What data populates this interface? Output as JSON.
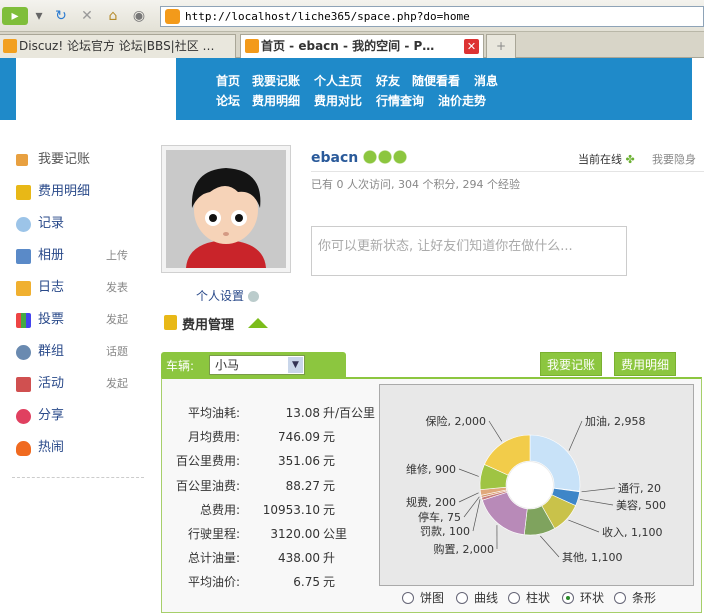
{
  "browser": {
    "url": "http://localhost/liche365/space.php?do=home",
    "tabs": [
      {
        "label": "Discuz! 论坛官方 论坛|BBS|社区 …"
      },
      {
        "label": "首页 - ebacn - 我的空间 - P…"
      }
    ]
  },
  "nav": {
    "row1": [
      "首页",
      "我要记账",
      "个人主页",
      "好友",
      "随便看看",
      "消息"
    ],
    "row2": [
      "论坛",
      "费用明细",
      "费用对比",
      "行情查询",
      "油价走势"
    ]
  },
  "sidebar": {
    "items": [
      {
        "label": "我要记账",
        "sub": ""
      },
      {
        "label": "费用明细",
        "sub": ""
      },
      {
        "label": "记录",
        "sub": ""
      },
      {
        "label": "相册",
        "sub": "上传"
      },
      {
        "label": "日志",
        "sub": "发表"
      },
      {
        "label": "投票",
        "sub": "发起"
      },
      {
        "label": "群组",
        "sub": "话题"
      },
      {
        "label": "活动",
        "sub": "发起"
      },
      {
        "label": "分享",
        "sub": ""
      },
      {
        "label": "热闹",
        "sub": ""
      }
    ]
  },
  "profile": {
    "username": "ebacn",
    "stats": "已有 0 人次访问, 304 个积分, 294 个经验",
    "online": "当前在线",
    "invisible": "我要隐身",
    "status_placeholder": "你可以更新状态, 让好友们知道你在做什么...",
    "settings": "个人设置"
  },
  "expense": {
    "title": "费用管理",
    "car_label": "车辆:",
    "car_value": "小马",
    "btn_record": "我要记账",
    "btn_detail": "费用明细",
    "stats": [
      {
        "label": "平均油耗:",
        "value": "13.08",
        "unit": "升/百公里"
      },
      {
        "label": "月均费用:",
        "value": "746.09",
        "unit": "元"
      },
      {
        "label": "百公里费用:",
        "value": "351.06",
        "unit": "元"
      },
      {
        "label": "百公里油费:",
        "value": "88.27",
        "unit": "元"
      },
      {
        "label": "总费用:",
        "value": "10953.10",
        "unit": "元"
      },
      {
        "label": "行驶里程:",
        "value": "3120.00",
        "unit": "公里"
      },
      {
        "label": "总计油量:",
        "value": "438.00",
        "unit": "升"
      },
      {
        "label": "平均油价:",
        "value": "6.75",
        "unit": "元"
      }
    ],
    "radios": [
      {
        "label": "饼图",
        "checked": false
      },
      {
        "label": "曲线",
        "checked": false
      },
      {
        "label": "柱状",
        "checked": false
      },
      {
        "label": "环状",
        "checked": true
      },
      {
        "label": "条形",
        "checked": false
      }
    ]
  },
  "chart_data": {
    "type": "pie",
    "style": "donut",
    "slices": [
      {
        "label": "加油",
        "value": 2958,
        "color": "#c8e2f8"
      },
      {
        "label": "通行",
        "value": 20,
        "color": "#3ea0e0"
      },
      {
        "label": "美容",
        "value": 500,
        "color": "#3e86c8"
      },
      {
        "label": "收入",
        "value": 1100,
        "color": "#c9c24a"
      },
      {
        "label": "其他",
        "value": 1100,
        "color": "#7fa35e"
      },
      {
        "label": "购置",
        "value": 2000,
        "color": "#b88ab8"
      },
      {
        "label": "罚款",
        "value": 100,
        "color": "#c77c7c"
      },
      {
        "label": "停车",
        "value": 75,
        "color": "#d99a6a"
      },
      {
        "label": "规费",
        "value": 200,
        "color": "#e0a87a"
      },
      {
        "label": "维修",
        "value": 900,
        "color": "#9fc443"
      },
      {
        "label": "保险",
        "value": 2000,
        "color": "#f2cc4a"
      }
    ]
  }
}
